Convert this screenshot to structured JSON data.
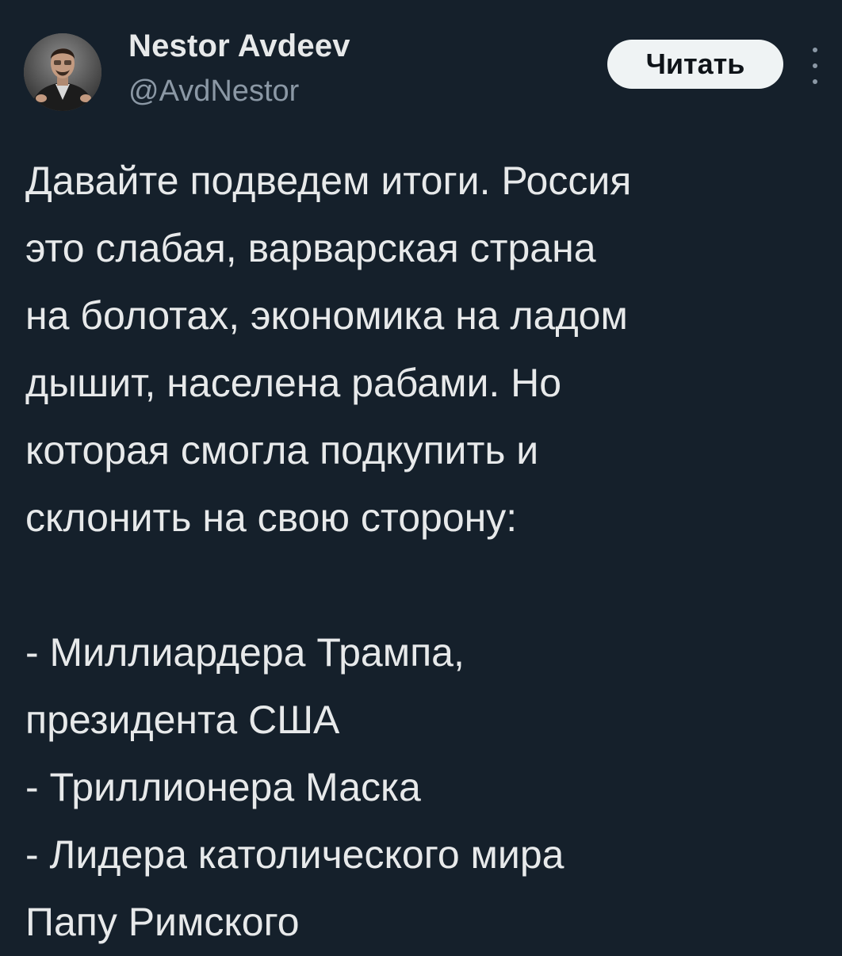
{
  "author": {
    "display_name": "Nestor Avdeev",
    "handle": "@AvdNestor",
    "avatar_icon": "user-avatar-photo"
  },
  "actions": {
    "follow_label": "Читать",
    "more_icon": "more-vertical-icon"
  },
  "tweet": {
    "paragraph_1": [
      "Давайте подведем итоги. Россия",
      "это слабая, варварская страна",
      "на болотах, экономика на ладом",
      "дышит, населена рабами. Но",
      "которая смогла подкупить и",
      "склонить на свою сторону:"
    ],
    "paragraph_2": [
      "- Миллиардера Трампа,",
      "президента США",
      "- Триллионера Маска",
      "- Лидера католического мира",
      "Папу Римского"
    ]
  },
  "colors": {
    "background": "#15202b",
    "text_primary": "#e7e9ea",
    "text_secondary": "#8b98a5",
    "button_bg": "#eff3f4",
    "button_text": "#0f1419"
  }
}
